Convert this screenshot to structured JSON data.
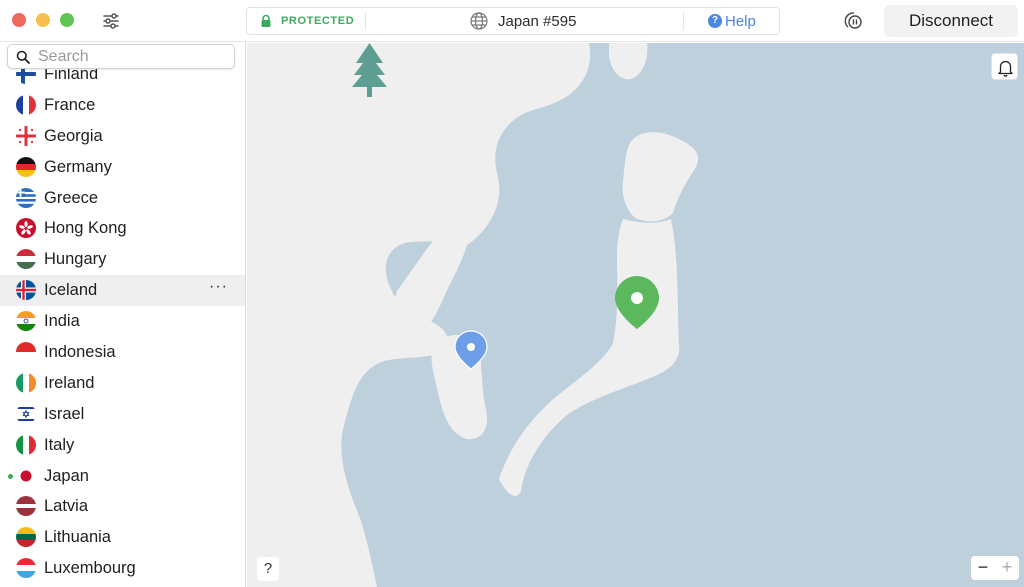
{
  "status": {
    "state": "PROTECTED",
    "server": "Japan #595",
    "help_label": "Help"
  },
  "actions": {
    "disconnect_label": "Disconnect"
  },
  "search": {
    "placeholder": "Search",
    "value": ""
  },
  "countries": [
    {
      "name": "Finland"
    },
    {
      "name": "France"
    },
    {
      "name": "Georgia"
    },
    {
      "name": "Germany"
    },
    {
      "name": "Greece"
    },
    {
      "name": "Hong Kong"
    },
    {
      "name": "Hungary"
    },
    {
      "name": "Iceland",
      "selected": true,
      "menu": "···"
    },
    {
      "name": "India"
    },
    {
      "name": "Indonesia"
    },
    {
      "name": "Ireland"
    },
    {
      "name": "Israel"
    },
    {
      "name": "Italy"
    },
    {
      "name": "Japan",
      "connected": true
    },
    {
      "name": "Latvia"
    },
    {
      "name": "Lithuania"
    },
    {
      "name": "Luxembourg"
    }
  ],
  "map": {
    "help_label": "?",
    "zoom_out_label": "−",
    "zoom_in_label": "+"
  },
  "colors": {
    "protected": "#3fa85e",
    "accent": "#4a86e8",
    "water": "#bfd0dd",
    "land": "#efefef",
    "tree": "#5e9e93",
    "pin_connected": "#5cb85c",
    "pin_location": "#6e9ee8"
  }
}
